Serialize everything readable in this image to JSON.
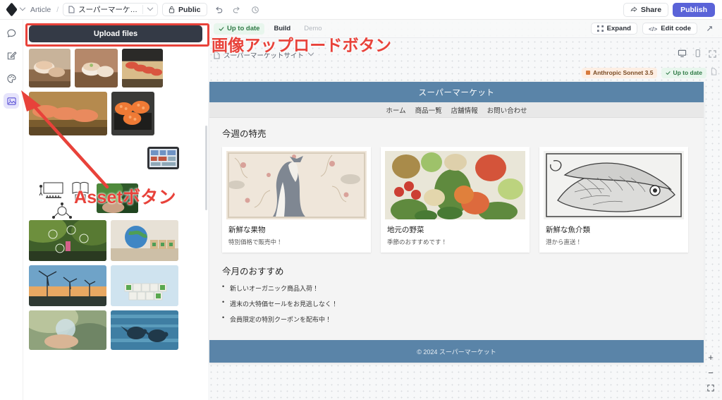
{
  "topbar": {
    "breadcrumb_label": "Article",
    "breadcrumb_separator": "/",
    "document_name": "スーパーマーケ…",
    "visibility_label": "Public",
    "share_label": "Share",
    "publish_label": "Publish",
    "icons": {
      "app_logo": "diamond-logo-icon",
      "app_menu": "chevron-down-icon",
      "document": "file-icon",
      "document_menu": "chevron-down-icon",
      "lock": "unlock-icon",
      "undo": "undo-icon",
      "redo": "redo-icon",
      "history": "history-icon",
      "share": "share-icon"
    }
  },
  "rail": {
    "items": [
      {
        "name": "chat",
        "icon": "chat-bubble-icon",
        "active": false
      },
      {
        "name": "edit",
        "icon": "pencil-square-icon",
        "active": false
      },
      {
        "name": "theme",
        "icon": "palette-icon",
        "active": false
      },
      {
        "name": "assets",
        "icon": "image-icon",
        "active": true
      }
    ]
  },
  "assets": {
    "upload_label": "Upload files",
    "thumbnails": [
      {
        "alt": "sushi-platter-wood",
        "w": 59,
        "h": 55
      },
      {
        "alt": "nigiri-sushi-closeup",
        "w": 61,
        "h": 55
      },
      {
        "alt": "sushi-roll-tray",
        "w": 58,
        "h": 55
      },
      {
        "alt": "salmon-nigiri-row",
        "w": 111,
        "h": 62
      },
      {
        "alt": "ikura-gunkan-sushi",
        "w": 61,
        "h": 62
      },
      {
        "alt": "tablet-device-mockup",
        "w": 45,
        "h": 32
      },
      {
        "alt": "presentation-line-art",
        "w": 40,
        "h": 30
      },
      {
        "alt": "book-laptop-line-art",
        "w": 30,
        "h": 32
      },
      {
        "alt": "network-node-line-art",
        "w": 34,
        "h": 28
      },
      {
        "alt": "hand-holding-sprout",
        "w": 59,
        "h": 42
      },
      {
        "alt": "eco-icons-over-plants",
        "w": 110,
        "h": 58
      },
      {
        "alt": "globe-with-eco-blocks",
        "w": 96,
        "h": 58
      },
      {
        "alt": "wind-turbines-sunset",
        "w": 110,
        "h": 58
      },
      {
        "alt": "carbon-neutral-blocks",
        "w": 96,
        "h": 58
      },
      {
        "alt": "hand-holding-water-globe",
        "w": 110,
        "h": 56
      },
      {
        "alt": "sea-turtles-swimming",
        "w": 96,
        "h": 56
      }
    ]
  },
  "canvas": {
    "status_label": "Up to date",
    "status_check": "check-icon",
    "tabs": [
      {
        "label": "Build",
        "active": true
      },
      {
        "label": "Demo",
        "active": false
      }
    ],
    "expand_label": "Expand",
    "expand_icon": "expand-icon",
    "edit_code_label": "Edit code",
    "edit_code_icon": "code-icon",
    "fullscreen_icon": "diagonal-arrow-icon",
    "frame_name": "スーパーマーケットサイト",
    "frame_icon": "file-icon",
    "frame_menu_icon": "chevron-down-icon",
    "device_icons": [
      "desktop-icon",
      "mobile-icon",
      "fit-screen-icon"
    ],
    "model_label": "Anthropic Sonnet 3.5",
    "model_status_label": "Up to date",
    "zoom_controls": [
      "+",
      "−",
      "fit-icon"
    ]
  },
  "site": {
    "header_title": "スーパーマーケット",
    "nav": [
      "ホーム",
      "商品一覧",
      "店舗情報",
      "お問い合わせ"
    ],
    "section_title": "今週の特売",
    "cards": [
      {
        "image": "fox-botanical-illustration",
        "title": "新鮮な果物",
        "desc": "特別価格で販売中！"
      },
      {
        "image": "vegetables-illustration",
        "title": "地元の野菜",
        "desc": "季節のおすすめです！"
      },
      {
        "image": "fish-engraving-illustration",
        "title": "新鮮な魚介類",
        "desc": "港から直送！"
      }
    ],
    "recommend_title": "今月のおすすめ",
    "recommend_items": [
      "新しいオーガニック商品入荷！",
      "週末の大特価セールをお見逃しなく！",
      "会員限定の特別クーポンを配布中！"
    ],
    "footer_text": "© 2024 スーパーマーケット",
    "colors": {
      "header": "#5a84a8",
      "nav": "#e8e8e8",
      "body": "#f4f4f4"
    }
  },
  "annotations": {
    "upload_label": "画像アップロードボタン",
    "asset_label": "Assetボタン",
    "color": "#e8423a"
  }
}
